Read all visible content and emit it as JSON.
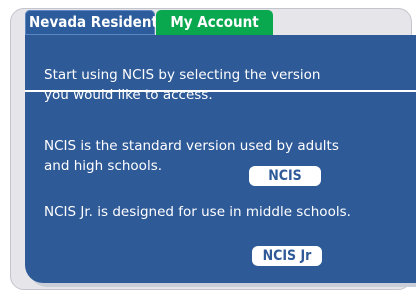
{
  "tabs": {
    "resident_label": "Nevada Resident",
    "account_label": "My Account"
  },
  "panel": {
    "intro_line1": "Start using NCIS by selecting the version",
    "intro_line2": "you would like to access.",
    "ncis_line1": "NCIS is the standard version used by adults",
    "ncis_line2": "and high schools.",
    "ncis_button": "NCIS",
    "jr_line": "NCIS Jr. is designed for use in middle schools.",
    "jr_button": "NCIS Jr"
  },
  "colors": {
    "panel_blue": "#2f5a98",
    "account_green": "#0aa84e",
    "background_card": "#e6e6ea"
  }
}
